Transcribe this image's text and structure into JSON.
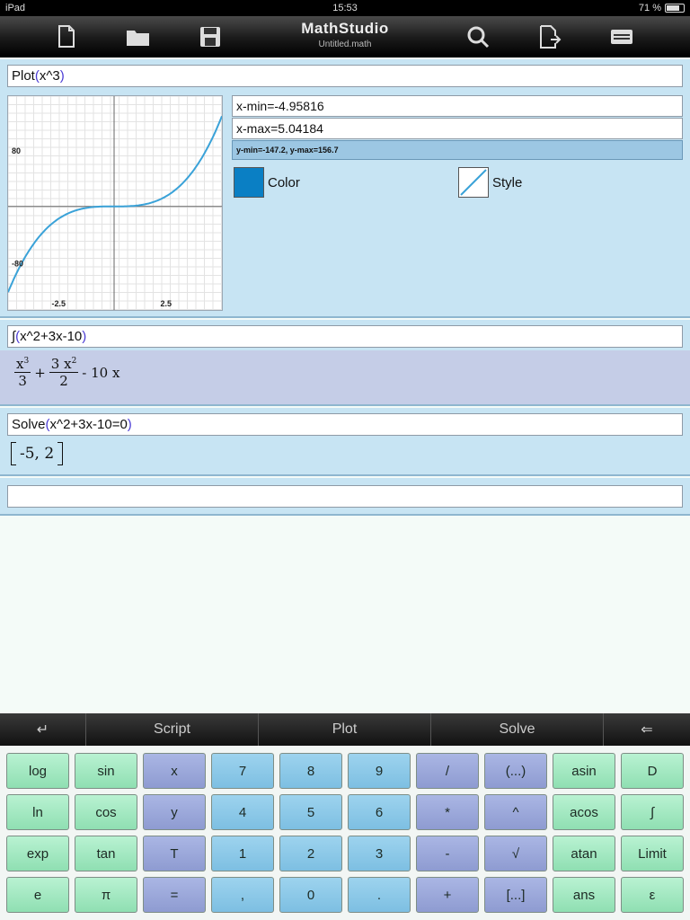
{
  "status": {
    "device": "iPad",
    "time": "15:53",
    "battery": "71 %"
  },
  "toolbar": {
    "title": "MathStudio",
    "filename": "Untitled.math",
    "buttons": [
      "new-icon",
      "open-icon",
      "save-icon",
      "search-icon",
      "export-icon",
      "keyboard-icon"
    ]
  },
  "cells": {
    "plot": {
      "fn": "Plot",
      "args": "x^3",
      "xmin": "x-min=-4.95816",
      "xmax": "x-max=5.04184",
      "ylim": "y-min=-147.2, y-max=156.7",
      "color_label": "Color",
      "style_label": "Style",
      "graph": {
        "y_top_label": "80",
        "y_bottom_label": "-80",
        "x_left_label": "-2.5",
        "x_right_label": "2.5"
      }
    },
    "integrate": {
      "fn": "∫",
      "args": "x^2+3x-10",
      "result": {
        "t1_num": "x",
        "t1_exp": "3",
        "t1_den": "3",
        "plus": "+",
        "t2_num": "3 x",
        "t2_exp": "2",
        "t2_den": "2",
        "rest": "- 10 x"
      }
    },
    "solve": {
      "fn": "Solve",
      "args": "x^2+3x-10=0",
      "result": "-5,  2"
    },
    "empty": {
      "value": ""
    }
  },
  "tabs": [
    {
      "label": "↵",
      "name": "enter-tab"
    },
    {
      "label": "Script",
      "name": "script-tab"
    },
    {
      "label": "Plot",
      "name": "plot-tab"
    },
    {
      "label": "Solve",
      "name": "solve-tab"
    },
    {
      "label": "⇐",
      "name": "backspace-tab"
    }
  ],
  "keys": [
    [
      "log",
      "sin",
      "x",
      "7",
      "8",
      "9",
      "/",
      "(...)",
      "asin",
      "D"
    ],
    [
      "ln",
      "cos",
      "y",
      "4",
      "5",
      "6",
      "*",
      "^",
      "acos",
      "∫"
    ],
    [
      "exp",
      "tan",
      "T",
      "1",
      "2",
      "3",
      "-",
      "√",
      "atan",
      "Limit"
    ],
    [
      "e",
      "π",
      "=",
      ",",
      "0",
      ".",
      "+",
      "[...]",
      "ans",
      "ε"
    ]
  ],
  "colors": {
    "accent": "#0a7fc4",
    "curve": "#3aa2d8",
    "cell_bg": "#c7e4f3",
    "result_bg": "#c5cde7"
  }
}
